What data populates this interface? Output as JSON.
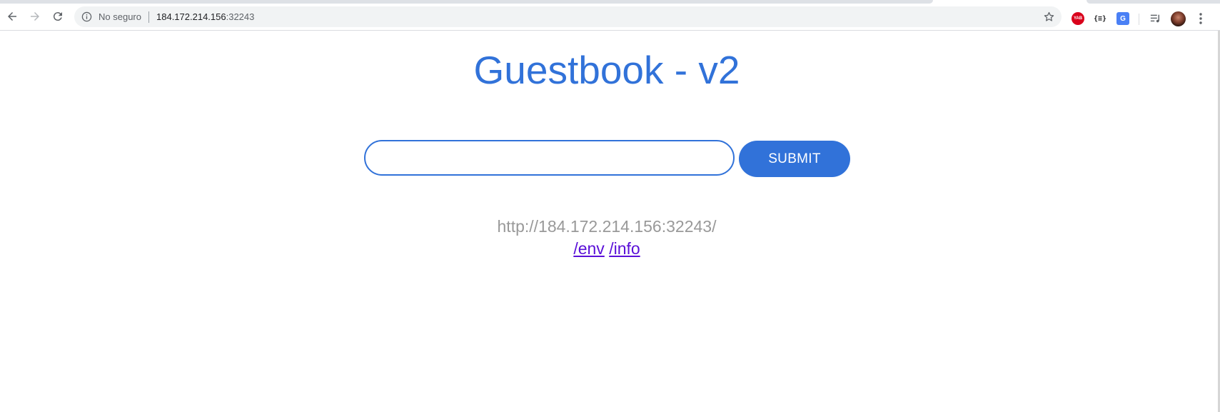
{
  "browser": {
    "security_label": "No seguro",
    "url_host": "184.172.214.156",
    "url_port": ":32243",
    "extensions": {
      "yab": "YAB",
      "json": "{≡}",
      "translate": "G"
    }
  },
  "page": {
    "title": "Guestbook - v2",
    "input": {
      "value": "",
      "placeholder": ""
    },
    "submit_label": "SUBMIT",
    "host_text": "http://184.172.214.156:32243/",
    "links": {
      "env": "/env",
      "info": "/info"
    }
  },
  "colors": {
    "accent": "#3172d9",
    "host_text": "#999999",
    "link": "#5a0fd8"
  },
  "icons": [
    "back-icon",
    "forward-icon",
    "reload-icon",
    "info-icon",
    "star-icon",
    "media-control-icon",
    "menu-icon"
  ]
}
